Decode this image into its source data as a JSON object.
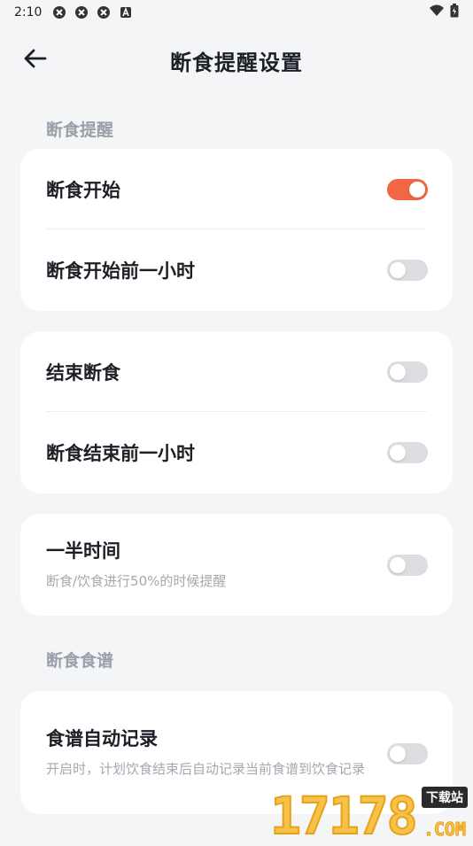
{
  "status_bar": {
    "time": "2:10",
    "icons": [
      "notification-icon",
      "notification-icon",
      "notification-icon",
      "text-icon"
    ],
    "right_icons": [
      "wifi-icon",
      "battery-icon"
    ]
  },
  "header": {
    "title": "断食提醒设置",
    "back_icon": "arrow-left-icon"
  },
  "sections": {
    "reminder_label": "断食提醒",
    "recipe_label": "断食食谱"
  },
  "rows": {
    "fast_start": {
      "label": "断食开始",
      "enabled": true
    },
    "fast_start_hour_before": {
      "label": "断食开始前一小时",
      "enabled": false
    },
    "end_fast": {
      "label": "结束断食",
      "enabled": false
    },
    "end_fast_hour_before": {
      "label": "断食结束前一小时",
      "enabled": false
    },
    "halfway": {
      "label": "一半时间",
      "desc": "断食/饮食进行50%的时候提醒",
      "enabled": false
    },
    "recipe_auto_record": {
      "label": "食谱自动记录",
      "desc": "开启时，计划饮食结束后自动记录当前食谱到饮食记录",
      "enabled": false
    }
  },
  "colors": {
    "accent": "#f26645",
    "toggle_off": "#dcdde1",
    "background": "#f4f5f7"
  },
  "watermark": {
    "digits": "17178",
    "badge": "下载站",
    "suffix": ".COM"
  }
}
